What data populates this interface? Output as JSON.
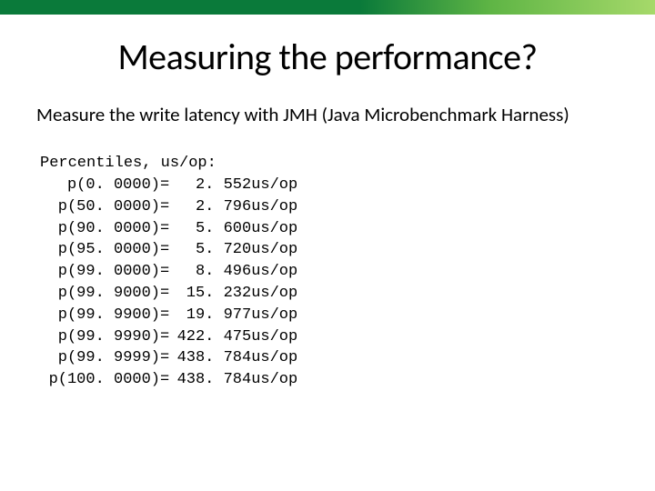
{
  "title": "Measuring the performance?",
  "subtitle": "Measure the write latency with JMH  (Java Microbenchmark Harness)",
  "perc_header": "Percentiles, us/op:",
  "unit": "us/op",
  "rows": [
    {
      "label": "p(0. 0000)",
      "eq": "=",
      "value": "2. 552"
    },
    {
      "label": "p(50. 0000)",
      "eq": "=",
      "value": "2. 796"
    },
    {
      "label": "p(90. 0000)",
      "eq": "=",
      "value": "5. 600"
    },
    {
      "label": "p(95. 0000)",
      "eq": "=",
      "value": "5. 720"
    },
    {
      "label": "p(99. 0000)",
      "eq": "=",
      "value": "8. 496"
    },
    {
      "label": "p(99. 9000)",
      "eq": "=",
      "value": "15. 232"
    },
    {
      "label": "p(99. 9900)",
      "eq": "=",
      "value": "19. 977"
    },
    {
      "label": "p(99. 9990)",
      "eq": "=",
      "value": "422. 475"
    },
    {
      "label": "p(99. 9999)",
      "eq": "=",
      "value": "438. 784"
    },
    {
      "label": "p(100. 0000)",
      "eq": "=",
      "value": "438. 784"
    }
  ]
}
